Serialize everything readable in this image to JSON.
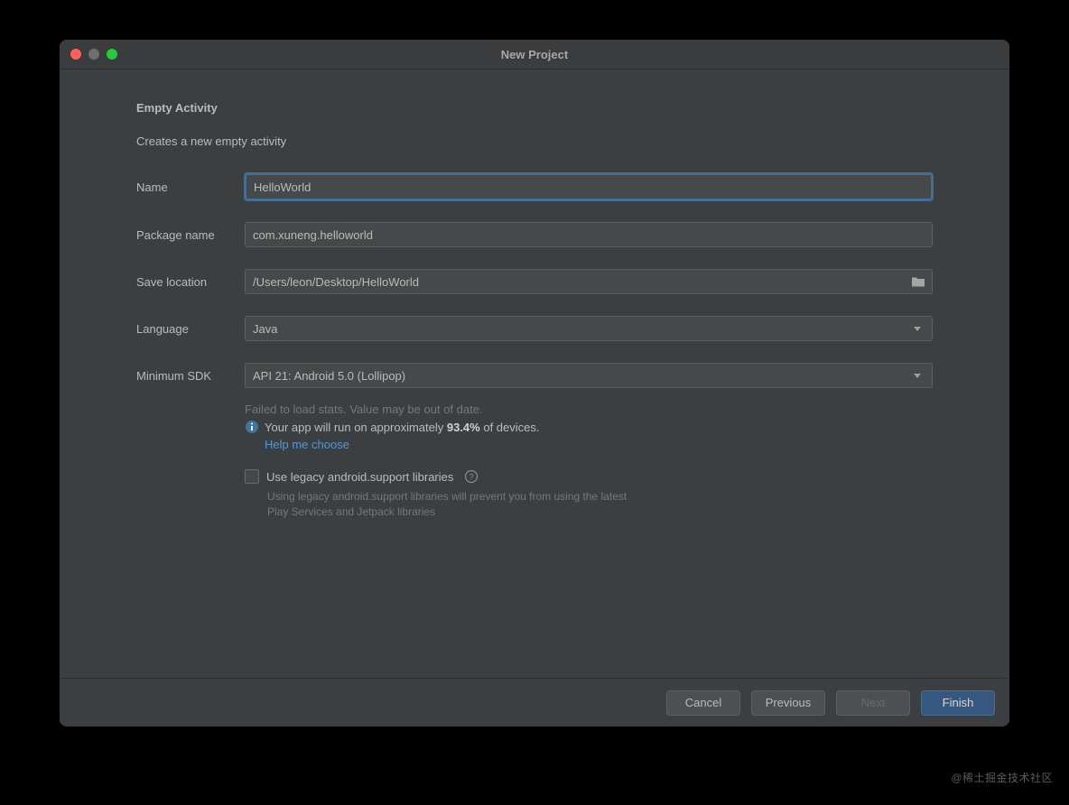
{
  "window": {
    "title": "New Project"
  },
  "heading": "Empty Activity",
  "subheading": "Creates a new empty activity",
  "form": {
    "name": {
      "label": "Name",
      "value": "HelloWorld"
    },
    "package": {
      "label": "Package name",
      "value": "com.xuneng.helloworld"
    },
    "save_location": {
      "label": "Save location",
      "value": "/Users/leon/Desktop/HelloWorld"
    },
    "language": {
      "label": "Language",
      "value": "Java"
    },
    "min_sdk": {
      "label": "Minimum SDK",
      "value": "API 21: Android 5.0 (Lollipop)"
    }
  },
  "info": {
    "stats_fail": "Failed to load stats. Value may be out of date.",
    "run_prefix": "Your app will run on approximately ",
    "percent": "93.4%",
    "run_suffix": " of devices.",
    "help_link": "Help me choose"
  },
  "legacy": {
    "label": "Use legacy android.support libraries",
    "hint": "Using legacy android.support libraries will prevent you from using the latest Play Services and Jetpack libraries"
  },
  "buttons": {
    "cancel": "Cancel",
    "previous": "Previous",
    "next": "Next",
    "finish": "Finish"
  },
  "watermark": "@稀土掘金技术社区"
}
